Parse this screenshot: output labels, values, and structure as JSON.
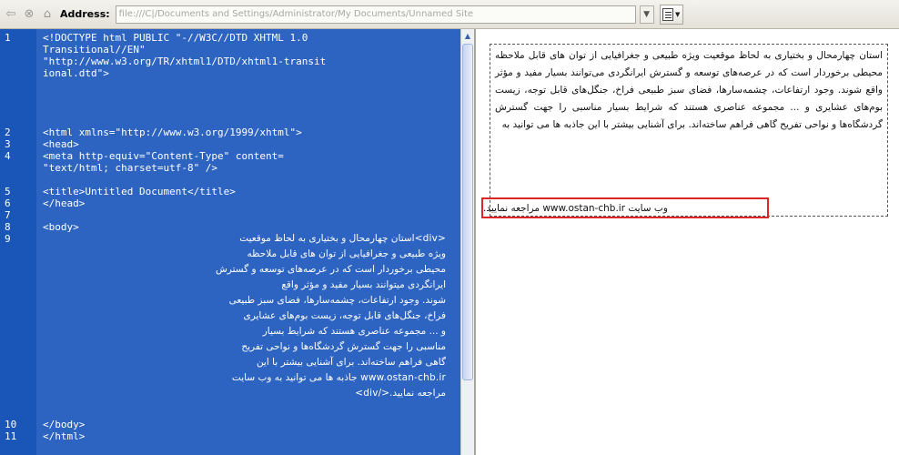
{
  "address": {
    "label": "Address:",
    "url": "file:///C|/Documents and Settings/Administrator/My Documents/Unnamed Site"
  },
  "code": {
    "line_numbers": [
      "1",
      "2",
      "3",
      "4",
      "5",
      "6",
      "7",
      "8",
      "9",
      "10",
      "11"
    ],
    "lines": [
      "<!DOCTYPE html PUBLIC \"-//W3C//DTD XHTML 1.0",
      "Transitional//EN\"",
      "\"http://www.w3.org/TR/xhtml1/DTD/xhtml1-transit",
      "ional.dtd\">",
      "<html xmlns=\"http://www.w3.org/1999/xhtml\">",
      "<head>",
      "<meta http-equiv=\"Content-Type\" content=",
      "\"text/html; charset=utf-8\" />",
      "<title>Untitled Document</title>",
      "</head>",
      "",
      "<body>"
    ],
    "rtl_lines": [
      "<div>استان چهارمحال و بختیاری به لحاظ موقعیت",
      "ویژه طبیعی و جغرافیایی از توان های قابل ملاحظه",
      "محیطی برخوردار است که در عرصه‌های توسعه و گسترش",
      "ایرانگردی میتوانند بسیار مفید و مؤثر واقع",
      "شوند. وجود ارتفاعات، چشمه‌سارها، فضای سبز طبیعی",
      "فراخ، جنگل‌های قابل توجه، زیست بوم‌های عشایری",
      "و ... مجموعه عناصری هستند که شرایط بسیار",
      "مناسبی را جهت گسترش گردشگاه‌ها و نواحی تفریح",
      "گاهی فراهم ساخته‌اند. برای آشنایی بیشتر با این",
      "www.ostan-chb.ir جاذبه ها می توانید به وب سایت",
      "مراجعه نمایید.</div>"
    ],
    "closing_lines": [
      "</body>",
      "</html>"
    ]
  },
  "preview": {
    "paragraph": "استان چهارمحال و بختیاری به لحاظ موقعیت ویژه طبیعی و جغرافیایی از توان های قابل ملاحظه محیطی برخوردار است که در عرصه‌های توسعه و گسترش ایرانگردی می‌توانند بسیار مفید و مؤثر واقع شوند. وجود ارتفاعات، چشمه‌سارها، فضای سبز طبیعی فراخ، جنگل‌های قابل توجه، زیست بوم‌های عشایری و ... مجموعه عناصری هستند که شرایط بسیار مناسبی را جهت گسترش گردشگاه‌ها و نواحی تفریح گاهی فراهم ساخته‌اند. برای آشنایی بیشتر با این جاذبه ها می توانید به",
    "highlighted": "وب سایت www.ostan-chb.ir مراجعه نمایید."
  },
  "colors": {
    "code_background": "#2d64c2",
    "gutter": "#1a56b7",
    "highlight_border": "#e02525"
  }
}
